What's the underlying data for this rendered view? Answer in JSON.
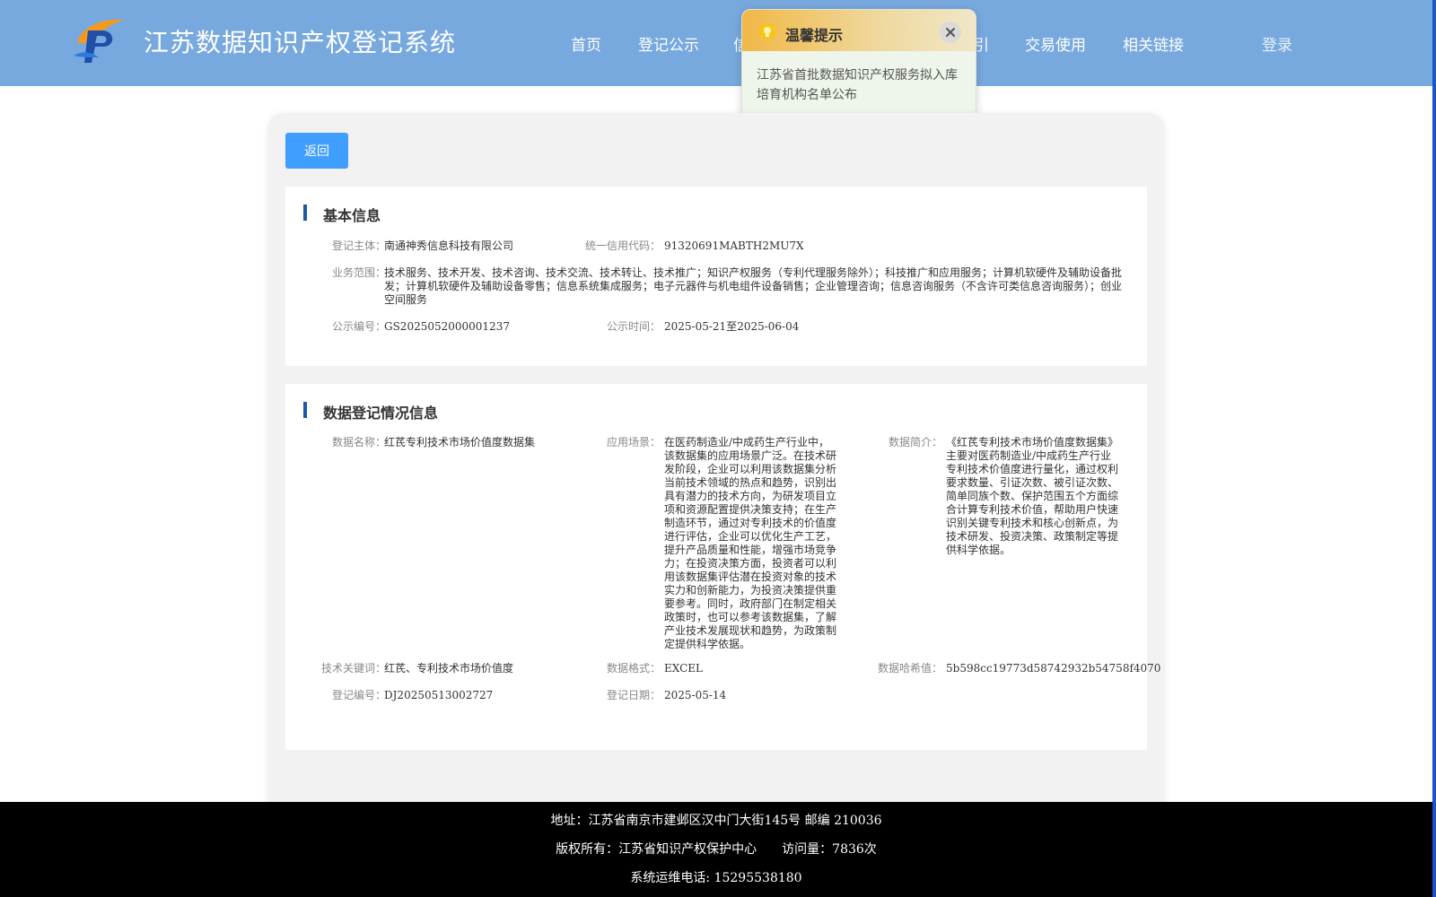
{
  "header": {
    "title": "江苏数据知识产权登记系统",
    "nav": [
      "首页",
      "登记公示",
      "信",
      "引",
      "交易使用",
      "相关链接"
    ],
    "login": "登录",
    "colors": {
      "header_bg": "#78a9de",
      "accent_blue": "#409eff"
    }
  },
  "notice": {
    "title": "温馨提示",
    "body": "江苏省首批数据知识产权服务拟入库培育机构名单公布",
    "icon": "lightbulb-icon",
    "close_icon": "close-icon"
  },
  "back_button": "返回",
  "basic_info": {
    "title": "基本信息",
    "subject_label": "登记主体：",
    "subject_value": "南通神秀信息科技有限公司",
    "credit_label": "统一信用代码：",
    "credit_value": "91320691MABTH2MU7X",
    "scope_label": "业务范围：",
    "scope_value": "技术服务、技术开发、技术咨询、技术交流、技术转让、技术推广；知识产权服务（专利代理服务除外）；科技推广和应用服务；计算机软硬件及辅助设备批发；计算机软硬件及辅助设备零售；信息系统集成服务；电子元器件与机电组件设备销售；企业管理咨询；信息咨询服务（不含许可类信息咨询服务）；创业空间服务",
    "pub_no_label": "公示编号：",
    "pub_no_value": "GS2025052000001237",
    "pub_time_label": "公示时间：",
    "pub_time_value": "2025-05-21至2025-06-04"
  },
  "data_info": {
    "title": "数据登记情况信息",
    "name_label": "数据名称：",
    "name_value": "红芪专利技术市场价值度数据集",
    "scene_label": "应用场景：",
    "scene_value": "在医药制造业/中成药生产行业中，该数据集的应用场景广泛。在技术研发阶段，企业可以利用该数据集分析当前技术领域的热点和趋势，识别出具有潜力的技术方向，为研发项目立项和资源配置提供决策支持；在生产制造环节，通过对专利技术的价值度进行评估，企业可以优化生产工艺，提升产品质量和性能，增强市场竞争力；在投资决策方面，投资者可以利用该数据集评估潜在投资对象的技术实力和创新能力，为投资决策提供重要参考。同时，政府部门在制定相关政策时，也可以参考该数据集，了解产业技术发展现状和趋势，为政策制定提供科学依据。",
    "intro_label": "数据简介：",
    "intro_value": "《红芪专利技术市场价值度数据集》主要对医药制造业/中成药生产行业专利技术价值度进行量化，通过权利要求数量、引证次数、被引证次数、简单同族个数、保护范围五个方面综合计算专利技术价值，帮助用户快速识别关键专利技术和核心创新点，为技术研发、投资决策、政策制定等提供科学依据。",
    "keyword_label": "技术关键词：",
    "keyword_value": "红芪、专利技术市场价值度",
    "format_label": "数据格式：",
    "format_value": "EXCEL",
    "hash_label": "数据哈希值：",
    "hash_value": "5b598cc19773d58742932b54758f4070",
    "reg_no_label": "登记编号：",
    "reg_no_value": "DJ20250513002727",
    "reg_date_label": "登记日期：",
    "reg_date_value": "2025-05-14"
  },
  "footer": {
    "address": "地址：江苏省南京市建邺区汉中门大街145号 邮编 210036",
    "copyright": "版权所有：江苏省知识产权保护中心　　访问量：7836次",
    "phone": "系统运维电话: 15295538180"
  }
}
